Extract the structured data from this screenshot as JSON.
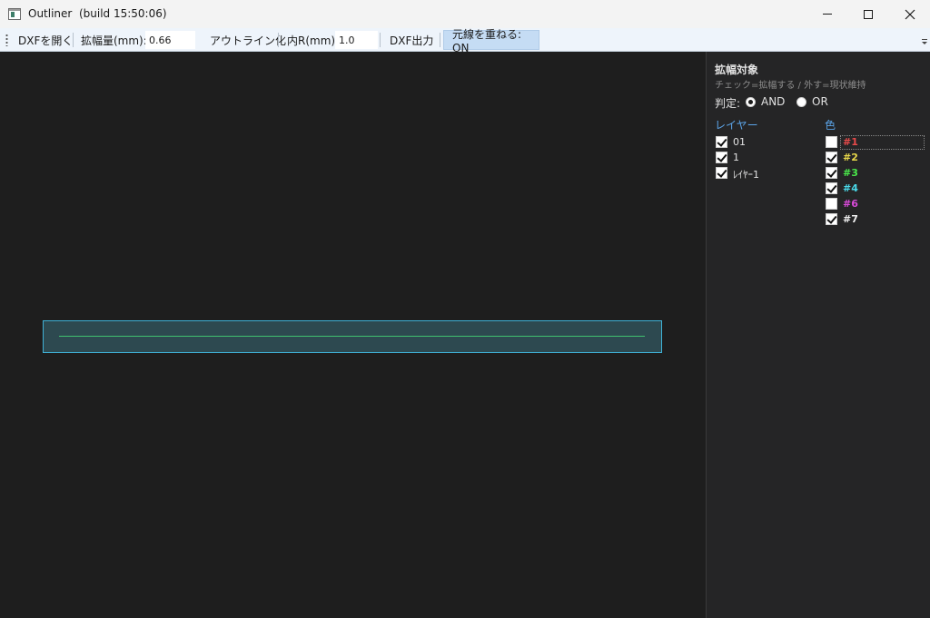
{
  "window": {
    "title": "Outliner  (build 15:50:06)",
    "controls": {
      "minimize": "minimize",
      "maximize": "maximize",
      "close": "close"
    }
  },
  "toolbar": {
    "open_dxf": "DXFを開く",
    "expand_label": "拡幅量(mm):",
    "expand_value": "0.66",
    "outline_button": "アウトライン化",
    "inner_r_label": "内R(mm):",
    "inner_r_value": "1.0",
    "dxf_out": "DXF出力",
    "overlay_toggle": "元線を重ねる: ON"
  },
  "canvas": {
    "shape_fill": "#2d4950",
    "shape_outline": "#3fb1d6",
    "line_color": "#3fc26f"
  },
  "panel": {
    "title": "拡幅対象",
    "subtitle": "チェック=拡幅する / 外す=現状維持",
    "judge_label": "判定:",
    "judge_options": [
      {
        "label": "AND",
        "selected": true
      },
      {
        "label": "OR",
        "selected": false
      }
    ],
    "layers_header": "レイヤー",
    "layers": [
      {
        "label": "01",
        "checked": true
      },
      {
        "label": "1",
        "checked": true
      },
      {
        "label": "ﾚｲﾔｰ1",
        "checked": true
      }
    ],
    "colors_header": "色",
    "colors": [
      {
        "label": "#1",
        "color": "#e84a4a",
        "checked": false
      },
      {
        "label": "#2",
        "color": "#e8d84a",
        "checked": true
      },
      {
        "label": "#3",
        "color": "#4ae84a",
        "checked": true
      },
      {
        "label": "#4",
        "color": "#4ad8e8",
        "checked": true
      },
      {
        "label": "#6",
        "color": "#d84ad8",
        "checked": false
      },
      {
        "label": "#7",
        "color": "#f0f0f0",
        "checked": true
      }
    ]
  }
}
